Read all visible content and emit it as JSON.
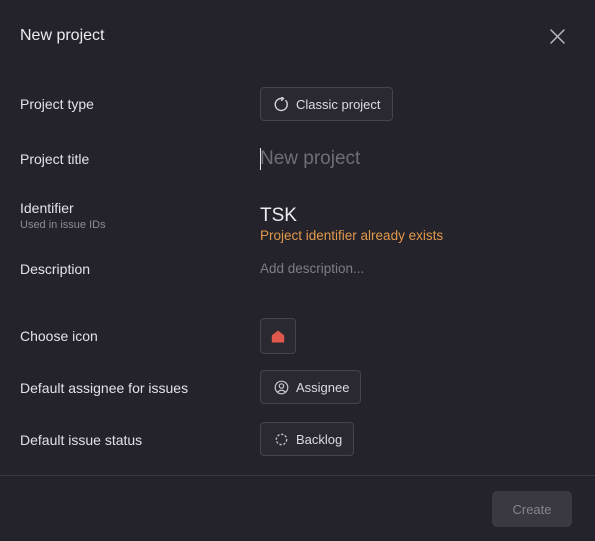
{
  "dialog": {
    "title": "New project",
    "close_icon": "close-icon"
  },
  "fields": {
    "project_type": {
      "label": "Project type",
      "value": "Classic project",
      "icon": "refresh-circle-icon"
    },
    "project_title": {
      "label": "Project title",
      "value": "",
      "placeholder": "New project"
    },
    "identifier": {
      "label": "Identifier",
      "sublabel": "Used in issue IDs",
      "value": "TSK",
      "error": "Project identifier already exists"
    },
    "description": {
      "label": "Description",
      "placeholder": "Add description..."
    },
    "icon": {
      "label": "Choose icon",
      "icon": "home-icon",
      "color": "#e0584c"
    },
    "default_assignee": {
      "label": "Default assignee for issues",
      "value": "Assignee",
      "icon": "user-circle-icon"
    },
    "default_status": {
      "label": "Default issue status",
      "value": "Backlog",
      "icon": "dashed-circle-icon"
    }
  },
  "footer": {
    "create_label": "Create"
  },
  "colors": {
    "background": "#24232b",
    "error": "#e3994b",
    "border": "#45444d"
  }
}
